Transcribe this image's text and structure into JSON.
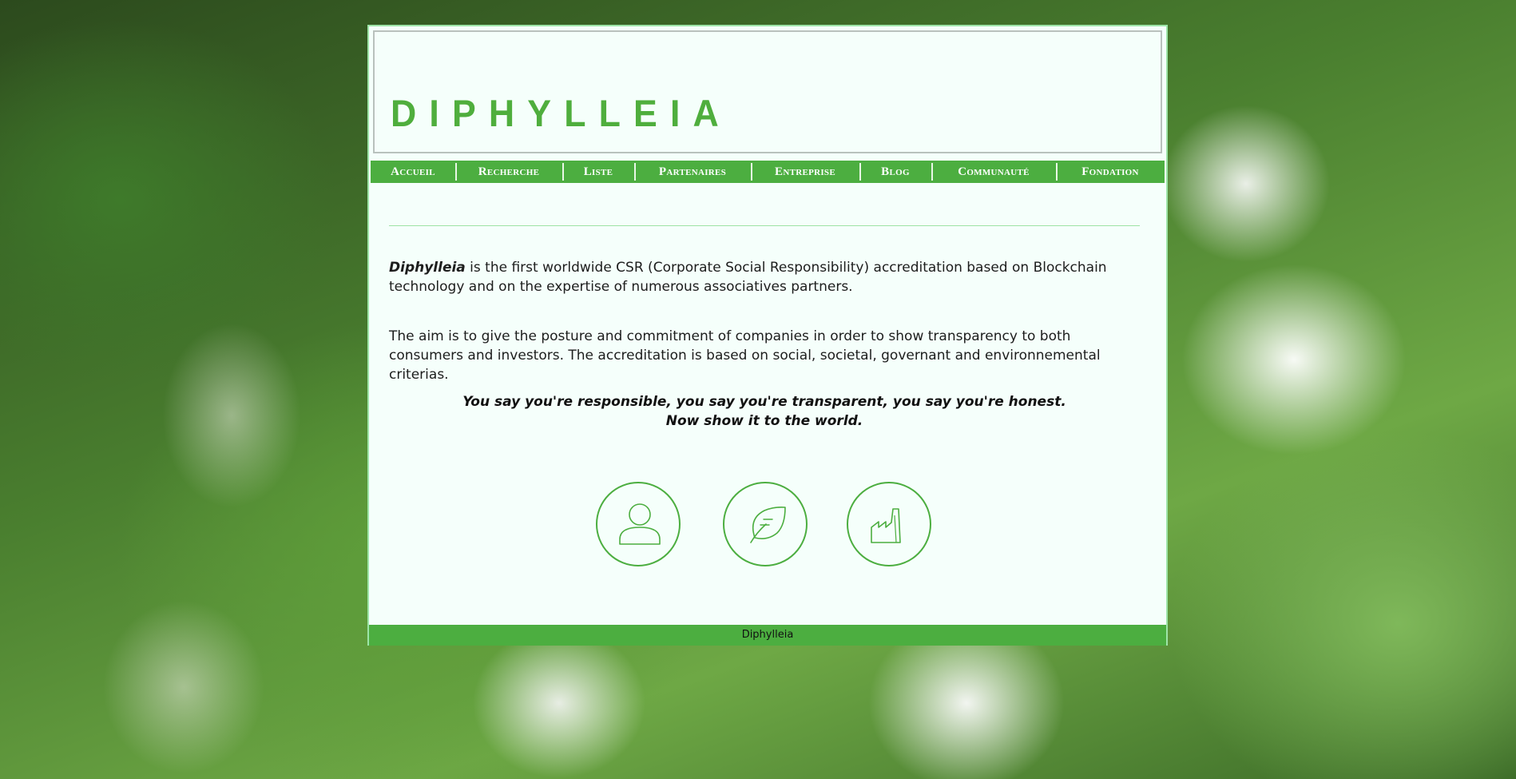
{
  "header": {
    "logo_text": "DIPHYLLEIA"
  },
  "nav": {
    "items": [
      {
        "label": "Accueil"
      },
      {
        "label": "Recherche"
      },
      {
        "label": "Liste"
      },
      {
        "label": "Partenaires"
      },
      {
        "label": "Entreprise"
      },
      {
        "label": "Blog"
      },
      {
        "label": "Communauté"
      },
      {
        "label": "Fondation"
      }
    ]
  },
  "main": {
    "intro_brand": "Diphylleia",
    "intro_text": " is the first worldwide CSR (Corporate Social Responsibility) accreditation based on Blockchain technology and on the expertise of numerous associatives partners.",
    "aim_text": "The aim is to give the posture and commitment of companies in order to show transparency to both consumers and investors. The accreditation is based on social, societal, governant and environnemental criterias.",
    "quote_line1": "You say you're responsible, you say you're transparent, you say you're honest.",
    "quote_line2": "Now show it to the world.",
    "icons": [
      "person-icon",
      "leaf-icon",
      "factory-icon"
    ]
  },
  "footer": {
    "text": "Diphylleia"
  },
  "colors": {
    "accent": "#4cae40",
    "page_bg": "#f5fffb",
    "border": "#9ee5a8"
  }
}
